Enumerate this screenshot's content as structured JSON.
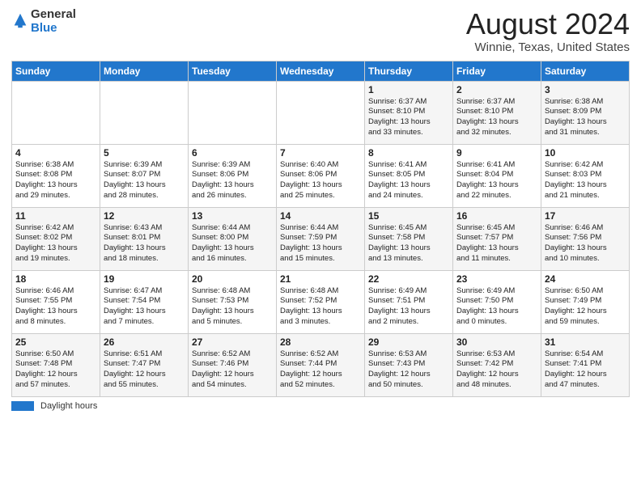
{
  "header": {
    "logo_general": "General",
    "logo_blue": "Blue",
    "month_year": "August 2024",
    "location": "Winnie, Texas, United States"
  },
  "days_of_week": [
    "Sunday",
    "Monday",
    "Tuesday",
    "Wednesday",
    "Thursday",
    "Friday",
    "Saturday"
  ],
  "weeks": [
    [
      {
        "day": "",
        "info": ""
      },
      {
        "day": "",
        "info": ""
      },
      {
        "day": "",
        "info": ""
      },
      {
        "day": "",
        "info": ""
      },
      {
        "day": "1",
        "info": "Sunrise: 6:37 AM\nSunset: 8:10 PM\nDaylight: 13 hours\nand 33 minutes."
      },
      {
        "day": "2",
        "info": "Sunrise: 6:37 AM\nSunset: 8:10 PM\nDaylight: 13 hours\nand 32 minutes."
      },
      {
        "day": "3",
        "info": "Sunrise: 6:38 AM\nSunset: 8:09 PM\nDaylight: 13 hours\nand 31 minutes."
      }
    ],
    [
      {
        "day": "4",
        "info": "Sunrise: 6:38 AM\nSunset: 8:08 PM\nDaylight: 13 hours\nand 29 minutes."
      },
      {
        "day": "5",
        "info": "Sunrise: 6:39 AM\nSunset: 8:07 PM\nDaylight: 13 hours\nand 28 minutes."
      },
      {
        "day": "6",
        "info": "Sunrise: 6:39 AM\nSunset: 8:06 PM\nDaylight: 13 hours\nand 26 minutes."
      },
      {
        "day": "7",
        "info": "Sunrise: 6:40 AM\nSunset: 8:06 PM\nDaylight: 13 hours\nand 25 minutes."
      },
      {
        "day": "8",
        "info": "Sunrise: 6:41 AM\nSunset: 8:05 PM\nDaylight: 13 hours\nand 24 minutes."
      },
      {
        "day": "9",
        "info": "Sunrise: 6:41 AM\nSunset: 8:04 PM\nDaylight: 13 hours\nand 22 minutes."
      },
      {
        "day": "10",
        "info": "Sunrise: 6:42 AM\nSunset: 8:03 PM\nDaylight: 13 hours\nand 21 minutes."
      }
    ],
    [
      {
        "day": "11",
        "info": "Sunrise: 6:42 AM\nSunset: 8:02 PM\nDaylight: 13 hours\nand 19 minutes."
      },
      {
        "day": "12",
        "info": "Sunrise: 6:43 AM\nSunset: 8:01 PM\nDaylight: 13 hours\nand 18 minutes."
      },
      {
        "day": "13",
        "info": "Sunrise: 6:44 AM\nSunset: 8:00 PM\nDaylight: 13 hours\nand 16 minutes."
      },
      {
        "day": "14",
        "info": "Sunrise: 6:44 AM\nSunset: 7:59 PM\nDaylight: 13 hours\nand 15 minutes."
      },
      {
        "day": "15",
        "info": "Sunrise: 6:45 AM\nSunset: 7:58 PM\nDaylight: 13 hours\nand 13 minutes."
      },
      {
        "day": "16",
        "info": "Sunrise: 6:45 AM\nSunset: 7:57 PM\nDaylight: 13 hours\nand 11 minutes."
      },
      {
        "day": "17",
        "info": "Sunrise: 6:46 AM\nSunset: 7:56 PM\nDaylight: 13 hours\nand 10 minutes."
      }
    ],
    [
      {
        "day": "18",
        "info": "Sunrise: 6:46 AM\nSunset: 7:55 PM\nDaylight: 13 hours\nand 8 minutes."
      },
      {
        "day": "19",
        "info": "Sunrise: 6:47 AM\nSunset: 7:54 PM\nDaylight: 13 hours\nand 7 minutes."
      },
      {
        "day": "20",
        "info": "Sunrise: 6:48 AM\nSunset: 7:53 PM\nDaylight: 13 hours\nand 5 minutes."
      },
      {
        "day": "21",
        "info": "Sunrise: 6:48 AM\nSunset: 7:52 PM\nDaylight: 13 hours\nand 3 minutes."
      },
      {
        "day": "22",
        "info": "Sunrise: 6:49 AM\nSunset: 7:51 PM\nDaylight: 13 hours\nand 2 minutes."
      },
      {
        "day": "23",
        "info": "Sunrise: 6:49 AM\nSunset: 7:50 PM\nDaylight: 13 hours\nand 0 minutes."
      },
      {
        "day": "24",
        "info": "Sunrise: 6:50 AM\nSunset: 7:49 PM\nDaylight: 12 hours\nand 59 minutes."
      }
    ],
    [
      {
        "day": "25",
        "info": "Sunrise: 6:50 AM\nSunset: 7:48 PM\nDaylight: 12 hours\nand 57 minutes."
      },
      {
        "day": "26",
        "info": "Sunrise: 6:51 AM\nSunset: 7:47 PM\nDaylight: 12 hours\nand 55 minutes."
      },
      {
        "day": "27",
        "info": "Sunrise: 6:52 AM\nSunset: 7:46 PM\nDaylight: 12 hours\nand 54 minutes."
      },
      {
        "day": "28",
        "info": "Sunrise: 6:52 AM\nSunset: 7:44 PM\nDaylight: 12 hours\nand 52 minutes."
      },
      {
        "day": "29",
        "info": "Sunrise: 6:53 AM\nSunset: 7:43 PM\nDaylight: 12 hours\nand 50 minutes."
      },
      {
        "day": "30",
        "info": "Sunrise: 6:53 AM\nSunset: 7:42 PM\nDaylight: 12 hours\nand 48 minutes."
      },
      {
        "day": "31",
        "info": "Sunrise: 6:54 AM\nSunset: 7:41 PM\nDaylight: 12 hours\nand 47 minutes."
      }
    ]
  ],
  "footer": {
    "swatch_label": "Daylight hours"
  }
}
